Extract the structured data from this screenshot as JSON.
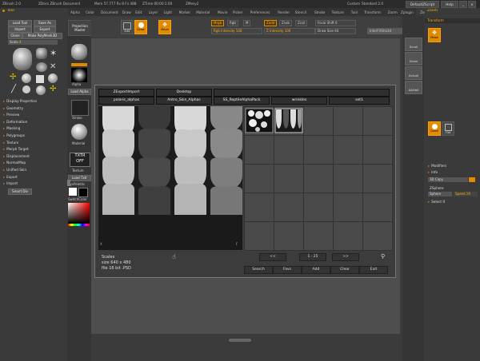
{
  "titlebar": {
    "app": "ZBrush 2.0",
    "doc": "ZDocs ZBrush Document",
    "mem": "Mem 57.777 Rx 8 Fx 488",
    "time": "ZTime 00:00:1.00",
    "zmem": "ZMesy2",
    "custom": "Custom",
    "standard": "Standard 2.0",
    "defaultscript": "DefaultZScript",
    "help": "Help"
  },
  "menu": [
    "Alpha",
    "Color",
    "Document",
    "Draw",
    "Edit",
    "Layer",
    "Light",
    "Marker",
    "Material",
    "Movie",
    "Picker",
    "Preferences",
    "Render",
    "Stencil",
    "Stroke",
    "Texture",
    "Tool",
    "Transform",
    "Zoom",
    "Zplugin",
    "Zscript"
  ],
  "left": {
    "tool_label": "Tool",
    "load_tool": "Load Tool",
    "save_as": "Save As",
    "import": "Import",
    "export": "Export",
    "clone": "Clone",
    "make_polymesh": "Make PolyMesh3D",
    "scale_label": "Scale",
    "menu_items": [
      "Display Properties",
      "Geometry",
      "Preview",
      "Deformation",
      "Masking",
      "Polygroups",
      "Texture",
      "Morph Target",
      "Displacement",
      "NormalMap",
      "Unified Skin",
      "Export",
      "Import"
    ],
    "smart": "Smart Div"
  },
  "strip": {
    "projection": "Projection Master",
    "alpha": "Alpha",
    "load_alpha": "Load Alpha",
    "stroke": "Stroke",
    "material": "Material",
    "txtr": "TXTR OFF",
    "texture": "Texture",
    "load_txtr": "Load Txtr",
    "sync": "SysPalette",
    "switch": "SwitchColor"
  },
  "shelf": {
    "edit": "Edit",
    "draw": "Draw",
    "move": "Move",
    "scale": "Scale",
    "rotate": "Rotate",
    "mrgb": "Mrgb",
    "rgb": "Rgb",
    "m": "M",
    "zadd": "Zadd",
    "zsub": "Zsub",
    "zcut": "Zcut",
    "focal": "Focal Shift 0",
    "rgb_int": "Rgb Intensity 100",
    "z_int": "Z Intensity 100",
    "draw_size": "Draw Size 64",
    "alpha_path": "InterFXSha3d"
  },
  "right": {
    "zoom_label": "Zoom",
    "transform": "Transform",
    "move_btn": "Move",
    "scroll": "Scroll",
    "zoom": "Zoom",
    "actual": "Actual",
    "aahalf": "AAHalf",
    "quick": "Quick",
    "flat": "Flat",
    "modifiers": "Modifiers",
    "info": "Info",
    "copy": "3D Copy",
    "sculpt": "ZSphere",
    "sphere": "Sphere",
    "speed": "Speed 19",
    "select": "Select It"
  },
  "dialog": {
    "tabs": [
      "ZExportImport",
      "Desktop"
    ],
    "folders": [
      "polaris_alphas",
      "Antro_Skin_Alphas",
      "SS_ReptileAlphaPack",
      "wrinkles",
      "set1"
    ],
    "nav_prev": "<<",
    "range": "1 - 25",
    "nav_next": ">>",
    "info_line1": "Scales",
    "info_line2": "size 640 x 480",
    "info_line3": "file 16 bit .PSD",
    "buttons": [
      "Search",
      "Favs",
      "Add",
      "Clear",
      "Exit"
    ]
  }
}
